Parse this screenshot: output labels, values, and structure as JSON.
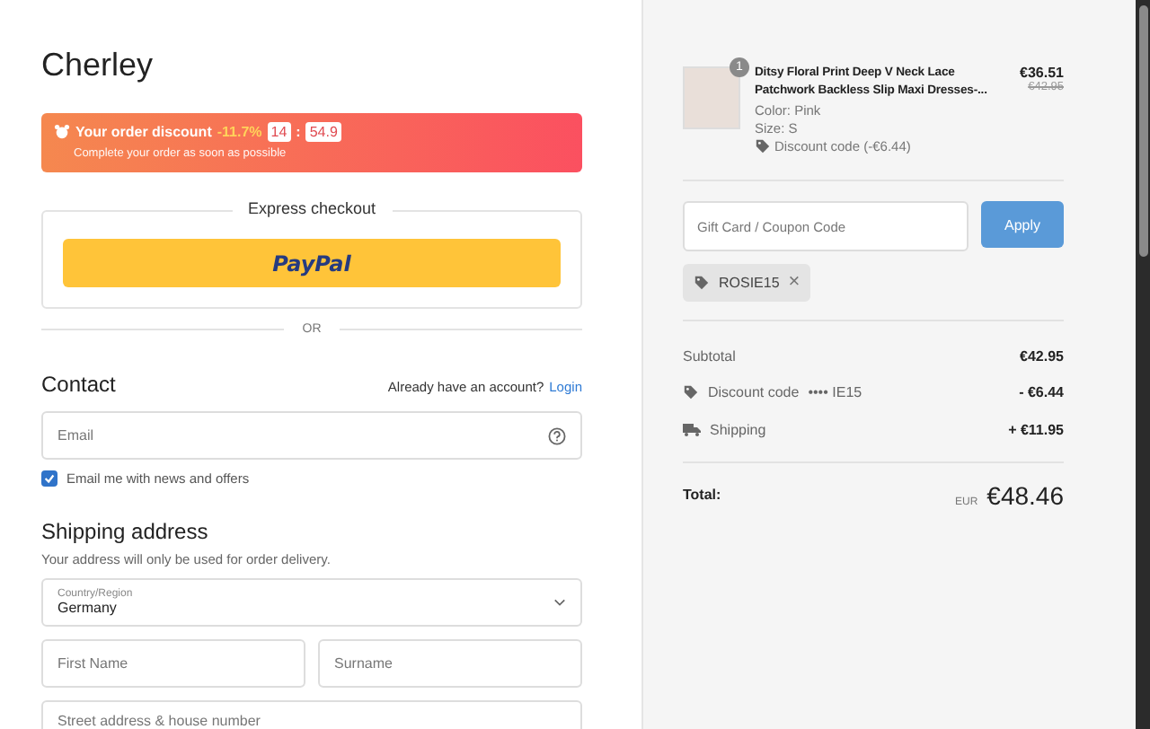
{
  "store": {
    "name": "Cherley"
  },
  "discount_banner": {
    "label": "Your order discount",
    "percent": "-11.7%",
    "timer_minutes": "14",
    "separator": ":",
    "timer_seconds": "54.9",
    "note": "Complete your order as soon as possible"
  },
  "express_checkout": {
    "title": "Express checkout",
    "button": "PayPal"
  },
  "divider": "OR",
  "contact": {
    "heading": "Contact",
    "account_prompt": "Already have an account?",
    "login_link": "Login",
    "email": {
      "placeholder": "Email"
    },
    "newsletter": {
      "label": "Email me with news and offers",
      "checked": true
    }
  },
  "shipping": {
    "heading": "Shipping address",
    "note": "Your address will only be used for order delivery.",
    "country": {
      "label": "Country/Region",
      "value": "Germany"
    },
    "first_name": {
      "placeholder": "First Name"
    },
    "surname": {
      "placeholder": "Surname"
    },
    "street": {
      "placeholder": "Street address & house number"
    }
  },
  "order_item": {
    "quantity": "1",
    "title": "Ditsy Floral Print Deep V Neck Lace Patchwork Backless Slip Maxi Dresses-...",
    "color_label": "Color: Pink",
    "size": "Size: S",
    "discount": "Discount code (-€6.44)",
    "price": "€36.51",
    "original_price": "€42.95"
  },
  "coupon": {
    "placeholder": "Gift Card / Coupon Code",
    "button": "Apply",
    "applied_code": "ROSIE15",
    "remove": "×"
  },
  "totals": [
    {
      "kind": "plain",
      "label": "Subtotal",
      "value": "€42.95"
    },
    {
      "kind": "discount",
      "label": "Discount code",
      "code": "•••• IE15",
      "value": "- €6.44"
    },
    {
      "kind": "shipping",
      "label": "Shipping",
      "value": "+ €11.95"
    }
  ],
  "total": {
    "label": "Total:",
    "currency": "EUR",
    "value": "€48.46"
  }
}
